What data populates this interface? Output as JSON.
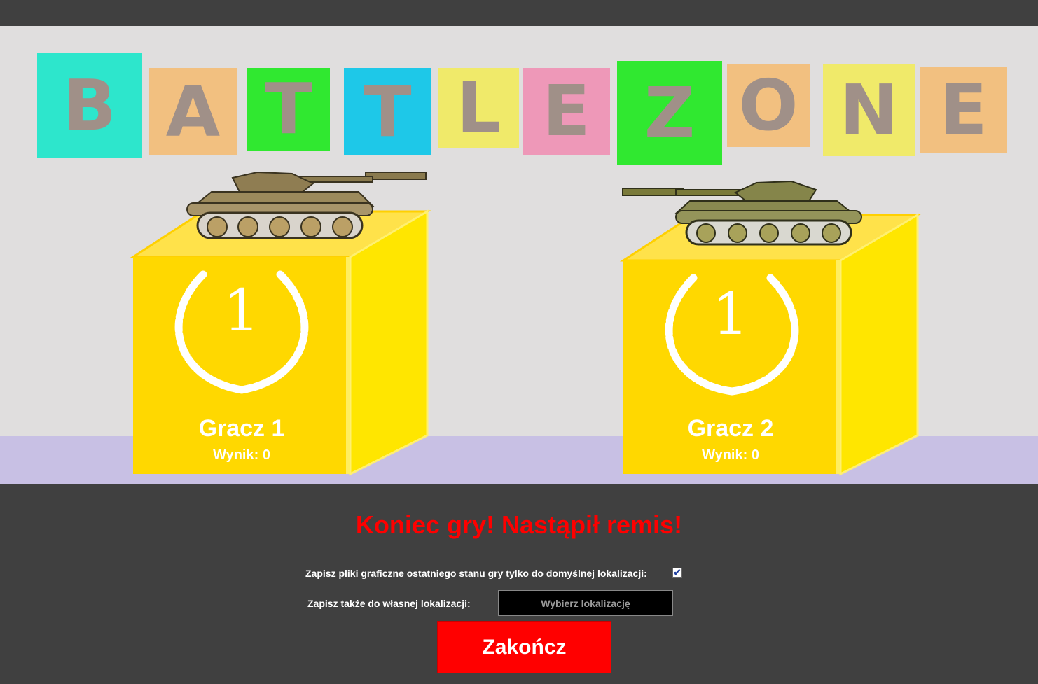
{
  "title_letters": [
    "B",
    "A",
    "T",
    "T",
    "L",
    "E",
    "Z",
    "O",
    "N",
    "E"
  ],
  "tile_colors": [
    "#2de6cc",
    "#f2c080",
    "#30e830",
    "#1ec8e8",
    "#f0ea6a",
    "#ee98b8",
    "#30e830",
    "#f2c080",
    "#f0ea6a",
    "#f2c080"
  ],
  "players": [
    {
      "name": "Gracz 1",
      "score": "Wynik: 0",
      "place": "1"
    },
    {
      "name": "Gracz 2",
      "score": "Wynik: 0",
      "place": "1"
    }
  ],
  "result_message": "Koniec gry! Nastąpił remis!",
  "save_default": {
    "label": "Zapisz pliki graficzne ostatniego stanu gry tylko do domyślnej lokalizacji:",
    "checked": true,
    "check_glyph": "✔"
  },
  "save_custom": {
    "label": "Zapisz także do własnej lokalizacji:",
    "button_label": "Wybierz lokalizację"
  },
  "end_button_label": "Zakończ",
  "colors": {
    "podium": "#ffd800",
    "result": "#ff0000",
    "end_button": "#ff0000",
    "floor": "#c8c0e4",
    "wall": "#e0dede"
  }
}
